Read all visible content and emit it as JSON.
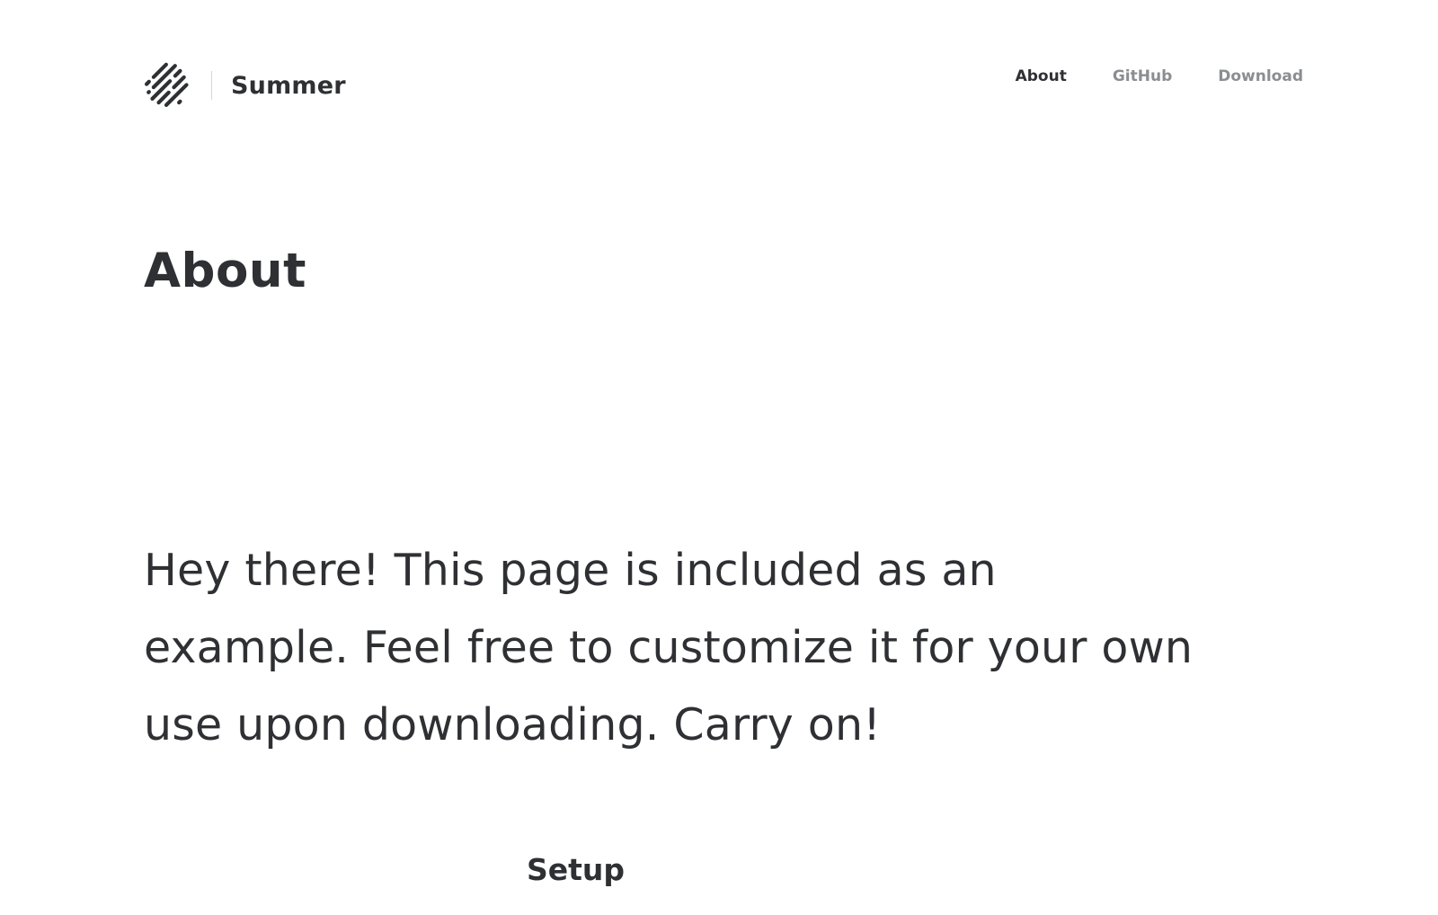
{
  "header": {
    "logo_icon": "diagonal-stripes-logo-icon",
    "brand_name": "Summer",
    "nav": [
      {
        "label": "About",
        "active": true
      },
      {
        "label": "GitHub",
        "active": false
      },
      {
        "label": "Download",
        "active": false
      }
    ]
  },
  "main": {
    "title": "About",
    "intro": "Hey there! This page is included as an example. Feel free to customize it for your own use upon downloading. Carry on!",
    "section_heading": "Setup"
  },
  "colors": {
    "text": "#2f3033",
    "nav_inactive": "#8a8d91",
    "divider": "#d4d6d9",
    "background": "#ffffff"
  }
}
